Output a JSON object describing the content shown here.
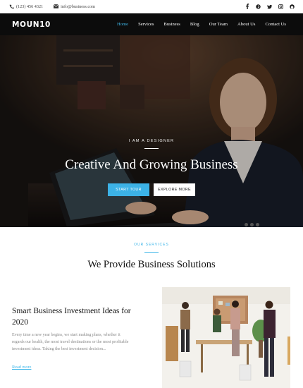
{
  "topbar": {
    "phone": "(123) 456 4321",
    "email": "info@business.com",
    "social_icons": [
      "facebook-icon",
      "pinterest-icon",
      "twitter-icon",
      "instagram-icon",
      "github-icon"
    ]
  },
  "nav": {
    "logo": "MOUN10",
    "items": [
      {
        "label": "Home",
        "active": true
      },
      {
        "label": "Services",
        "active": false
      },
      {
        "label": "Business",
        "active": false
      },
      {
        "label": "Blog",
        "active": false
      },
      {
        "label": "Our Team",
        "active": false
      },
      {
        "label": "About Us",
        "active": false
      },
      {
        "label": "Contact Us",
        "active": false
      }
    ]
  },
  "hero": {
    "kicker": "I AM A DESIGNER",
    "title": "Creative And Growing Business",
    "primary_button": "START TOUR",
    "secondary_button": "EXPLORE MORE"
  },
  "services": {
    "kicker": "OUR SERVICES",
    "title": "We Provide Business Solutions",
    "card": {
      "title": "Smart Business Investment Ideas for 2020",
      "text": "Every time a new year begins, we start making plans, whether it regards our health, the most travel destinations or the most profitable investment ideas. Taking the best investment decision...",
      "link": "Read more"
    }
  },
  "colors": {
    "accent": "#3cb2e6",
    "nav_bg": "#0c0c0c"
  }
}
